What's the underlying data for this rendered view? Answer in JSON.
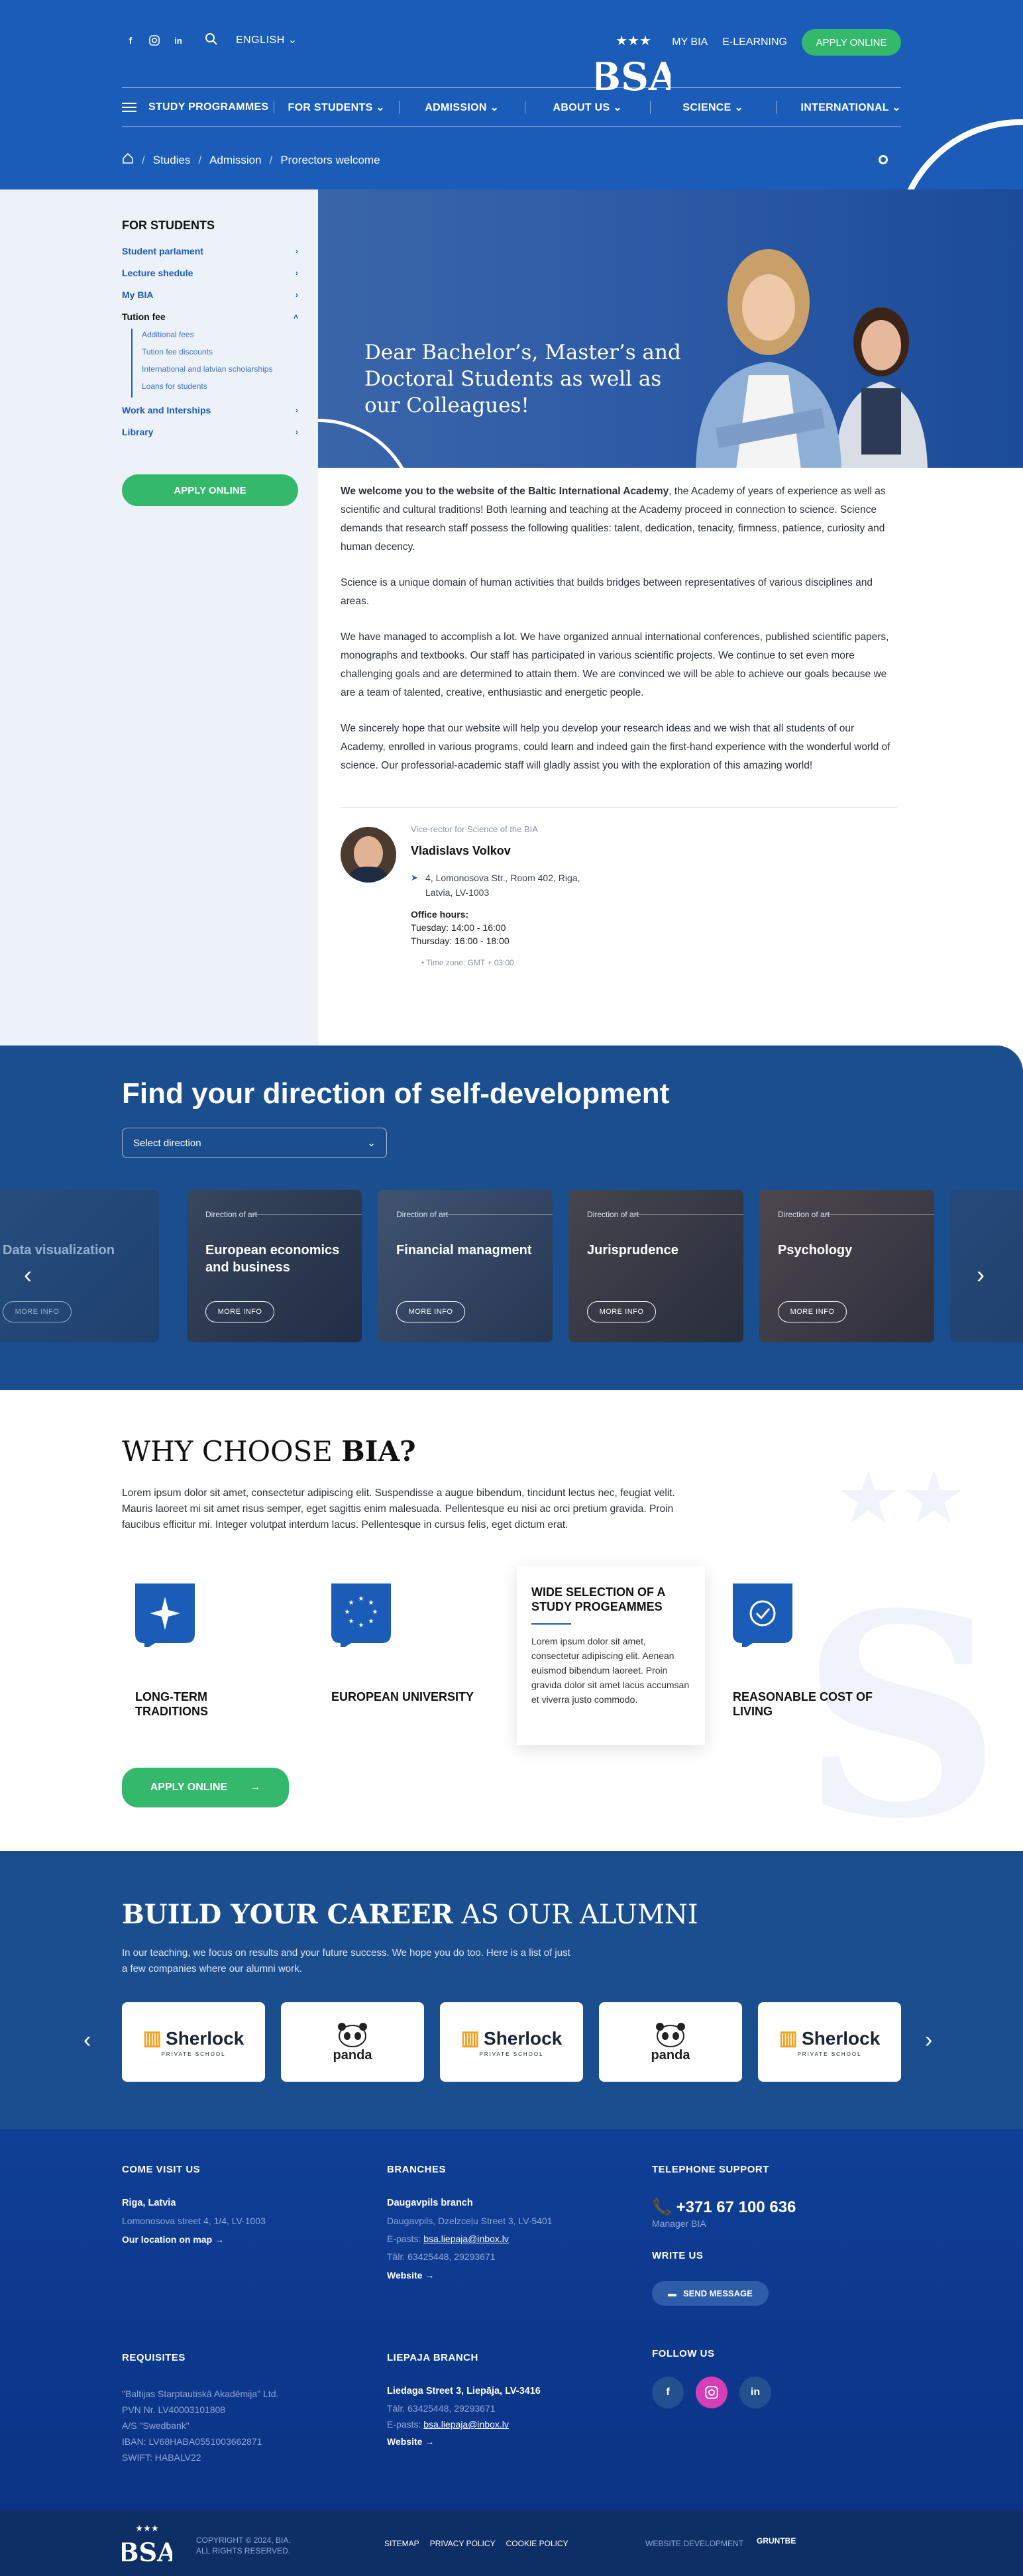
{
  "header": {
    "language": "ENGLISH",
    "my_bia": "MY BIA",
    "elearning": "E-LEARNING",
    "apply": "APPLY ONLINE",
    "nav": [
      "STUDY PROGRAMMES",
      "FOR STUDENTS",
      "ADMISSION",
      "ABOUT US",
      "SCIENCE",
      "INTERNATIONAL"
    ],
    "breadcrumbs": [
      "Studies",
      "Admission",
      "Prorectors welcome"
    ],
    "logo_text": "BSA"
  },
  "sidebar": {
    "heading": "FOR STUDENTS",
    "items": [
      "Student parlament",
      "Lecture shedule",
      "My BIA",
      "Tution fee"
    ],
    "subitems": [
      "Additional fees",
      "Tution fee discounts",
      "International and latvian scholarships",
      "Loans for students"
    ],
    "items2": [
      "Work and Interships",
      "Library"
    ],
    "apply": "APPLY ONLINE"
  },
  "hero": {
    "title": "Dear Bachelor’s, Master’s and Doctoral Students as well as our Colleagues!"
  },
  "article": {
    "p1_bold": "We welcome you to the website of the Baltic International Academy",
    "p1_rest": ", the Academy of years of experience as well as scientific and cultural traditions! Both learning and teaching at the Academy proceed in connection to science. Science demands that research staff possess the following qualities: talent, dedication, tenacity, firmness, patience, curiosity and human decency.",
    "p2": "Science is a unique domain of human activities that builds bridges between representatives of various disciplines and areas.",
    "p3": "We have managed to accomplish a lot. We have organized annual international conferences, published scientific papers, monographs and textbooks. Our staff has participated in various scientific projects. We continue to set even more challenging goals and are determined to attain them. We are convinced we will be able to achieve our goals because we are a team of talented, creative, enthusiastic and energetic people.",
    "p4": "We sincerely hope that our website will help you develop your research ideas and we wish that all students of our Academy, enrolled in various programs, could learn and indeed gain the first-hand experience with the wonderful world of science. Our professorial-academic staff will gladly assist you with the exploration of this amazing world!"
  },
  "contact": {
    "role": "Vice-rector for Science of the BIA",
    "name": "Vladislavs Volkov",
    "address_1": "4, Lomonosova Str., Room 402, Riga,",
    "address_2": "Latvia, LV-1003",
    "hours_label": "Office hours:",
    "hours_1": "Tuesday: 14:00 - 16:00",
    "hours_2": "Thursday: 16:00 - 18:00",
    "timezone": "Time zone: GMT + 03:00"
  },
  "direction": {
    "title": "Find your direction of self-development",
    "select_placeholder": "Select direction",
    "more": "MORE INFO",
    "tag": "Direction of art",
    "cards": [
      "Data visualization",
      "European economics and business",
      "Financial managment",
      "Jurisprudence",
      "Psychology"
    ]
  },
  "why": {
    "title_light": "WHY CHOOSE ",
    "title_bold": "BIA?",
    "text": "Lorem ipsum dolor sit amet, consectetur adipiscing elit. Suspendisse a augue bibendum, tincidunt lectus nec, feugiat velit. Mauris laoreet mi sit amet risus semper, eget sagittis enim malesuada. Pellentesque eu nisi ac orci pretium gravida. Proin faucibus efficitur mi. Integer volutpat interdum lacus. Pellentesque in cursus felis, eget dictum erat.",
    "features": [
      "LONG-TERM TRADITIONS",
      "EUROPEAN UNIVERSITY",
      "REASONABLE COST OF LIVING"
    ],
    "card_title": "WIDE SELECTION OF A STUDY PROGEAMMES",
    "card_text": "Lorem ipsum dolor sit amet, consectetur adipiscing elit. Aenean euismod bibendum laoreet. Proin gravida dolor sit amet lacus accumsan et viverra justo commodo.",
    "apply": "APPLY ONLINE"
  },
  "career": {
    "title_bold": "BUILD YOUR CAREER",
    "title_light": " AS OUR ALUMNI",
    "text": "In our teaching, we focus on results and your future success. We hope you do too. Here is a list of just a few companies where our alumni work.",
    "sherlock": "Sherlock",
    "sherlock_sub": "PRIVATE SCHOOL",
    "panda": "panda"
  },
  "footer": {
    "visit": "COME VISIT US",
    "visit_city": "Riga, Latvia",
    "visit_addr": "Lomonosova street 4, 1/4, LV-1003",
    "visit_link": "Our location on map",
    "branches": "BRANCHES",
    "br_name": "Daugavpils branch",
    "br_addr": "Daugavpils, Dzelzceļu Street 3, LV-5401",
    "br_email_label": "E-pasts:",
    "br_email": "bsa.liepaja@inbox.lv",
    "br_tel": "Tālr. 63425448, 29293671",
    "website": "Website",
    "phone": "TELEPHONE SUPPORT",
    "tel": "+371 67 100 636",
    "tel_sub": "Manager BIA",
    "write": "WRITE US",
    "send": "SEND MESSAGE",
    "req": "REQUISITES",
    "req_lines": [
      "\"Baltijas Starptautiskā Akadēmija\" Ltd.",
      "PVN Nr. LV40003101808",
      "A/S \"Swedbank\"",
      "IBAN: LV68HABA0551003662871",
      "SWIFT: HABALV22"
    ],
    "liepaja": "LIEPAJA BRANCH",
    "lp_name": "Liedaga Street 3, Liepāja, LV-3416",
    "lp_tel": "Tālr. 63425448, 29293671",
    "lp_email_label": "E-pasts:",
    "lp_email": "bsa.liepaja@inbox.lv",
    "follow": "FOLLOW US"
  },
  "bottom": {
    "copy1": "COPYRIGHT © 2024, BIA.",
    "copy2": "ALL RIGHTS RESERVED.",
    "privacy": "PRIVACY POLICY",
    "cookie": "COOKIE POLICY",
    "sitemap": "SITEMAP",
    "dev": "WEBSITE DEVELOPMENT",
    "dev_logo": "GRUNTBE"
  },
  "colors": {
    "primary": "#1a5cb8",
    "green": "#34b86c",
    "dark": "#1b4e8f"
  }
}
